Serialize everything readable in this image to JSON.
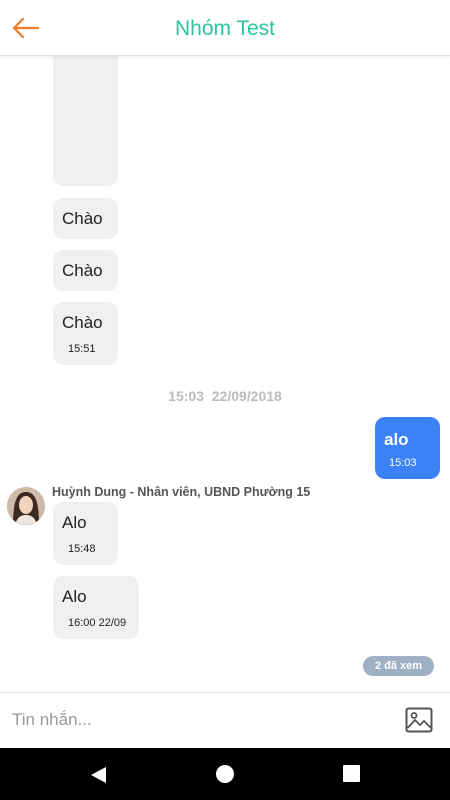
{
  "header": {
    "title": "Nhóm Test",
    "back_icon": "arrow-left-icon",
    "accent": "#2ac4a0",
    "back_color": "#f07a2a"
  },
  "messages_top": [
    {
      "text": "Chào",
      "time": ""
    },
    {
      "text": "Chào",
      "time": ""
    },
    {
      "text": "Chào",
      "time": "15:51"
    }
  ],
  "date_separator": "15:03  22/09/2018",
  "my_message": {
    "text": "alo",
    "time": "15:03",
    "color": "#3b82f6"
  },
  "sender": {
    "name": "Huỳnh Dung - Nhân viên, UBND Phường 15",
    "avatar_icon": "avatar-icon"
  },
  "messages_bottom": [
    {
      "text": "Alo",
      "time": "15:48"
    },
    {
      "text": "Alo",
      "time": "16:00 22/09"
    }
  ],
  "seen_badge": "2 đã xem",
  "composer": {
    "placeholder": "Tin nhắn...",
    "image_icon": "image-icon"
  },
  "navbar": {
    "back_icon": "nav-back-icon",
    "home_icon": "nav-home-icon",
    "recent_icon": "nav-recent-icon"
  }
}
